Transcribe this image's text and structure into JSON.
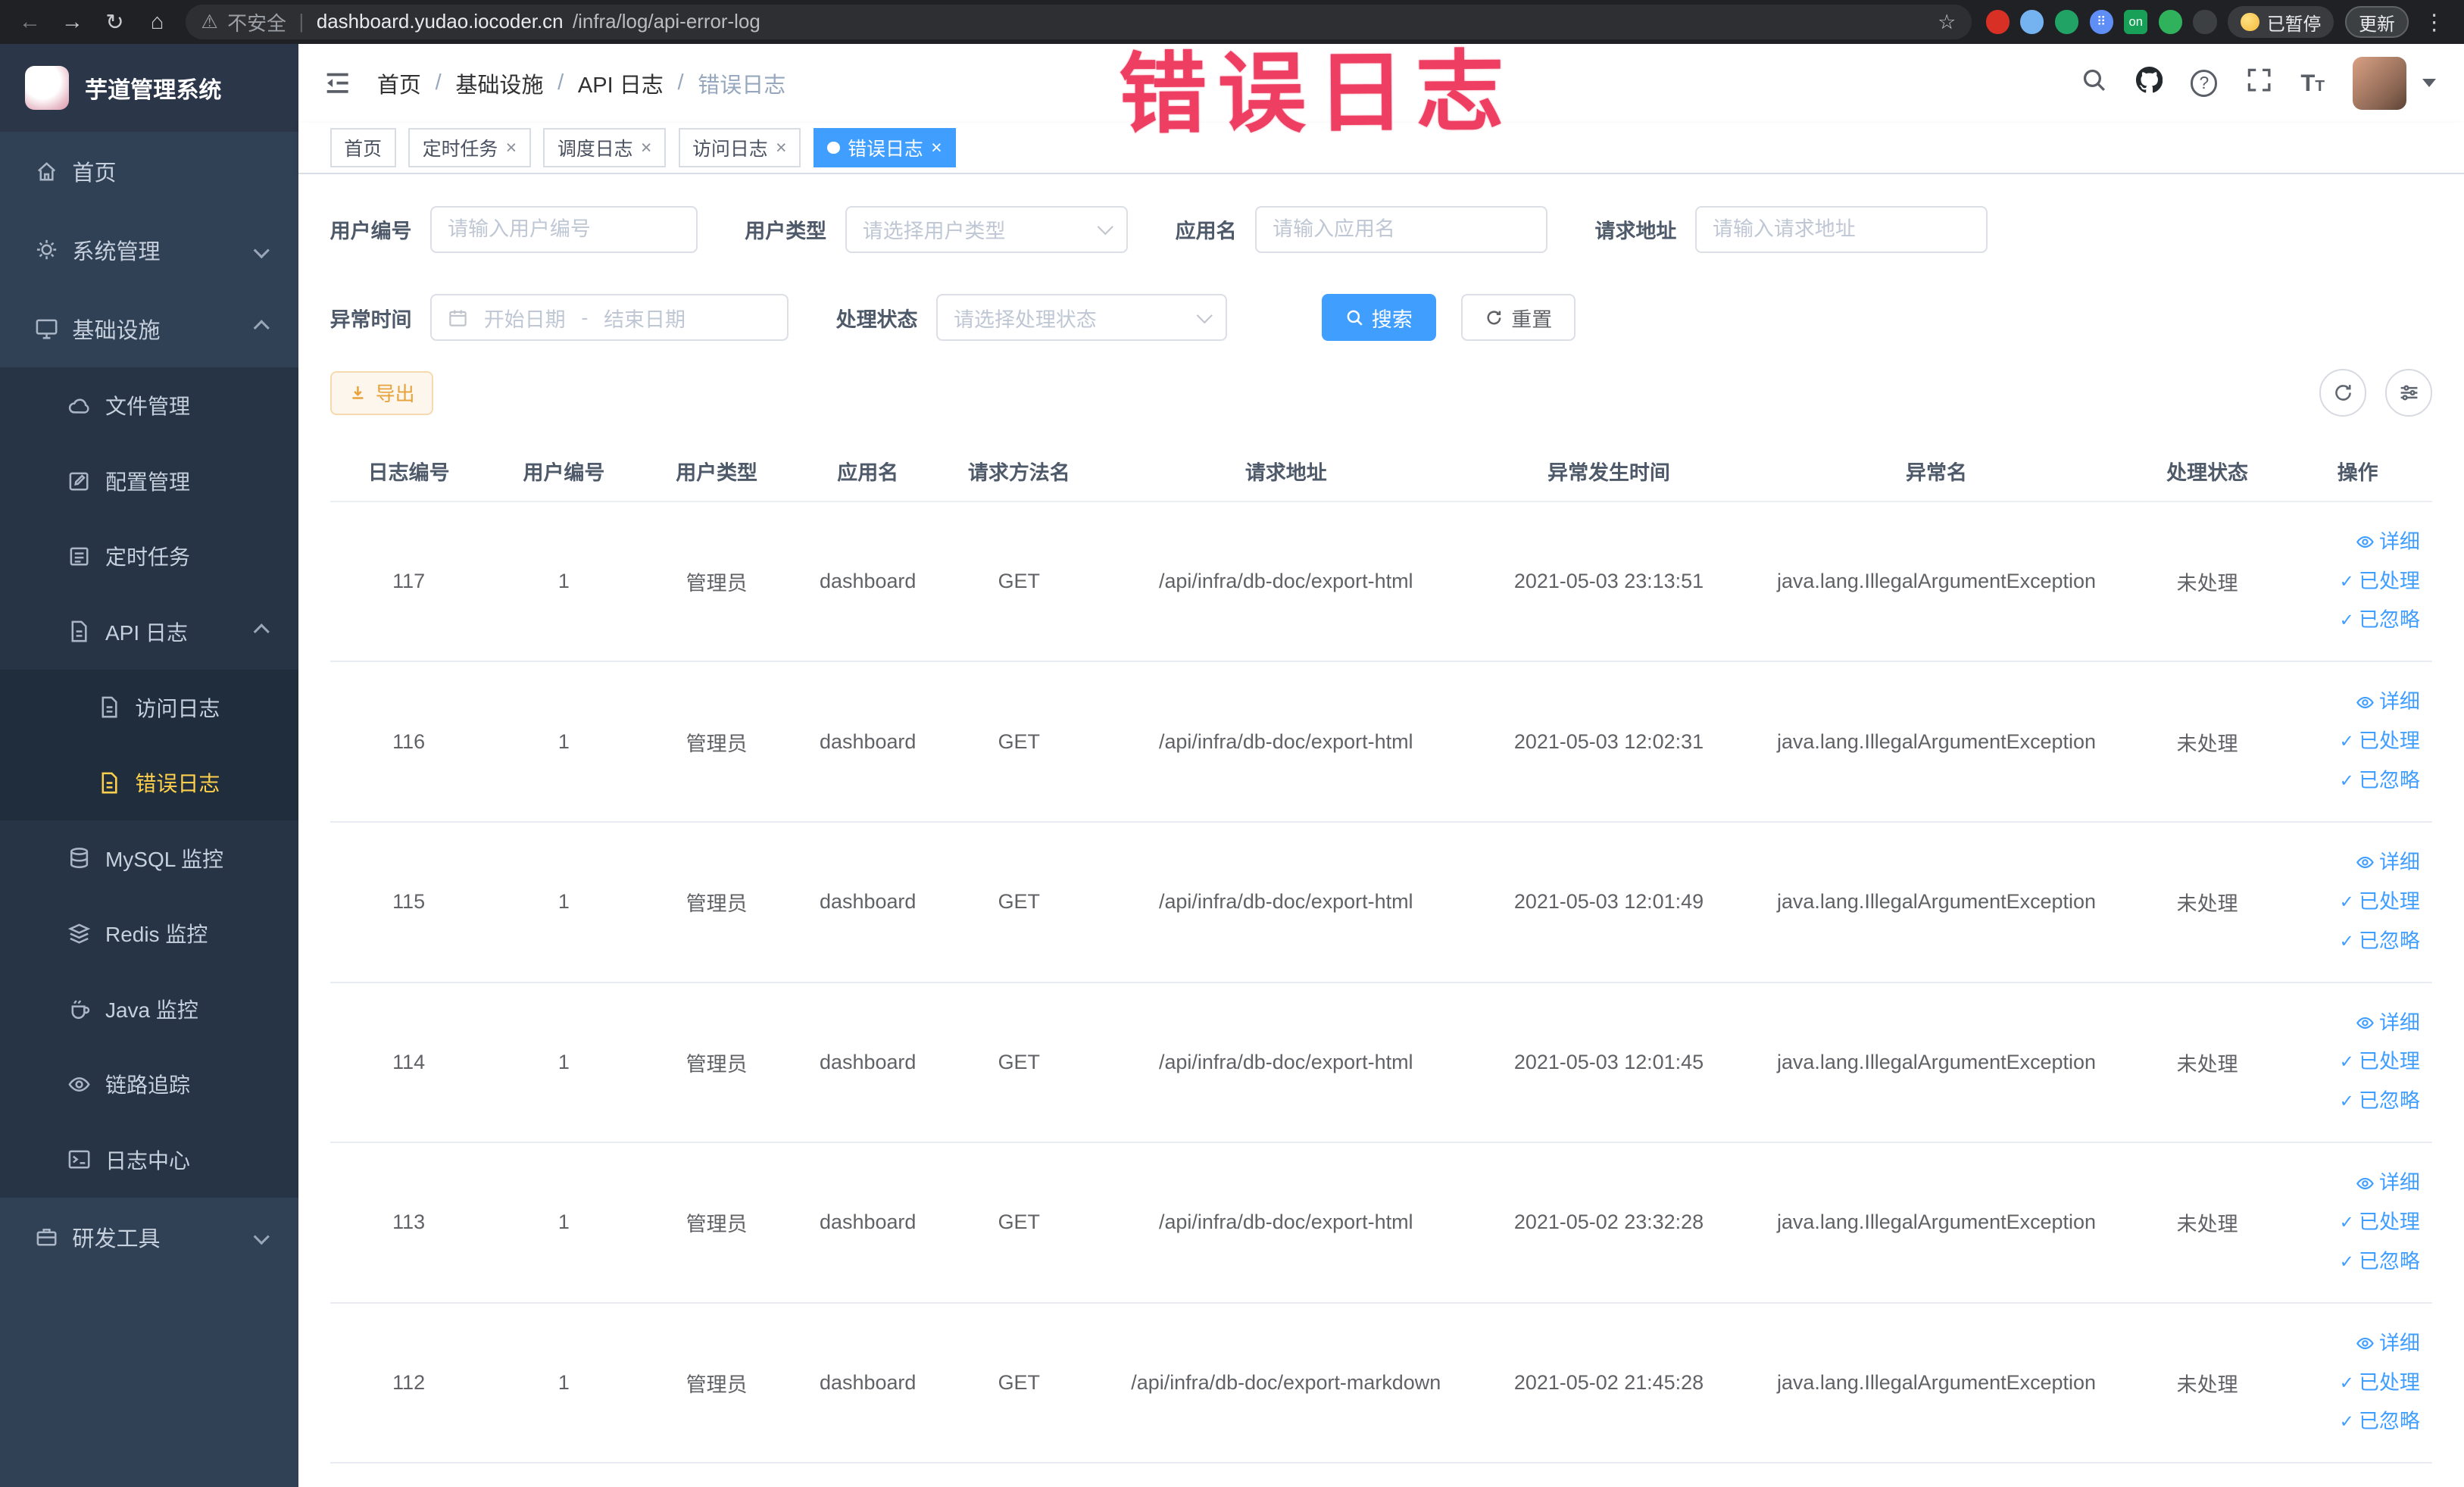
{
  "annotation": {
    "text": "错误日志",
    "color": "#ee3f63"
  },
  "browser": {
    "security_label": "不安全",
    "url_domain": "dashboard.yudao.iocoder.cn",
    "url_path": "/infra/log/api-error-log",
    "ext_on_label": "on",
    "paused_label": "已暂停",
    "update_label": "更新"
  },
  "sidebar": {
    "logo_title": "芋道管理系统",
    "items": [
      {
        "label": "首页",
        "icon": "home-icon",
        "level": 1
      },
      {
        "label": "系统管理",
        "icon": "gear-icon",
        "level": 1,
        "arrow": "down"
      },
      {
        "label": "基础设施",
        "icon": "monitor-icon",
        "level": 1,
        "arrow": "up"
      },
      {
        "label": "文件管理",
        "icon": "cloud-icon",
        "level": 2
      },
      {
        "label": "配置管理",
        "icon": "edit-icon",
        "level": 2
      },
      {
        "label": "定时任务",
        "icon": "list-icon",
        "level": 2
      },
      {
        "label": "API 日志",
        "icon": "doc-icon",
        "level": 2,
        "arrow": "up"
      },
      {
        "label": "访问日志",
        "icon": "doc-lines-icon",
        "level": 3
      },
      {
        "label": "错误日志",
        "icon": "doc-lines-icon",
        "level": 3,
        "active": true
      },
      {
        "label": "MySQL 监控",
        "icon": "database-icon",
        "level": 2
      },
      {
        "label": "Redis 监控",
        "icon": "layers-icon",
        "level": 2
      },
      {
        "label": "Java 监控",
        "icon": "coffee-icon",
        "level": 2
      },
      {
        "label": "链路追踪",
        "icon": "eye-icon",
        "level": 2
      },
      {
        "label": "日志中心",
        "icon": "terminal-icon",
        "level": 2
      },
      {
        "label": "研发工具",
        "icon": "briefcase-icon",
        "level": 1,
        "arrow": "down"
      }
    ]
  },
  "header": {
    "breadcrumb": [
      "首页",
      "基础设施",
      "API 日志",
      "错误日志"
    ]
  },
  "tabs": [
    {
      "label": "首页",
      "closable": false,
      "active": false
    },
    {
      "label": "定时任务",
      "closable": true,
      "active": false
    },
    {
      "label": "调度日志",
      "closable": true,
      "active": false
    },
    {
      "label": "访问日志",
      "closable": true,
      "active": false
    },
    {
      "label": "错误日志",
      "closable": true,
      "active": true
    }
  ],
  "filters": {
    "user_id": {
      "label": "用户编号",
      "placeholder": "请输入用户编号"
    },
    "user_type": {
      "label": "用户类型",
      "placeholder": "请选择用户类型"
    },
    "app_name": {
      "label": "应用名",
      "placeholder": "请输入应用名"
    },
    "request_url": {
      "label": "请求地址",
      "placeholder": "请输入请求地址"
    },
    "exception_time": {
      "label": "异常时间",
      "start_placeholder": "开始日期",
      "separator": "-",
      "end_placeholder": "结束日期"
    },
    "process_status": {
      "label": "处理状态",
      "placeholder": "请选择处理状态"
    },
    "search_label": "搜索",
    "reset_label": "重置"
  },
  "toolbar": {
    "export_label": "导出"
  },
  "table": {
    "columns": [
      "日志编号",
      "用户编号",
      "用户类型",
      "应用名",
      "请求方法名",
      "请求地址",
      "异常发生时间",
      "异常名",
      "处理状态",
      "操作"
    ],
    "actions": [
      "详细",
      "已处理",
      "已忽略"
    ],
    "rows": [
      {
        "id": "117",
        "user_id": "1",
        "user_type": "管理员",
        "app": "dashboard",
        "method": "GET",
        "url": "/api/infra/db-doc/export-html",
        "time": "2021-05-03 23:13:51",
        "exception": "java.lang.IllegalArgumentException",
        "status": "未处理"
      },
      {
        "id": "116",
        "user_id": "1",
        "user_type": "管理员",
        "app": "dashboard",
        "method": "GET",
        "url": "/api/infra/db-doc/export-html",
        "time": "2021-05-03 12:02:31",
        "exception": "java.lang.IllegalArgumentException",
        "status": "未处理"
      },
      {
        "id": "115",
        "user_id": "1",
        "user_type": "管理员",
        "app": "dashboard",
        "method": "GET",
        "url": "/api/infra/db-doc/export-html",
        "time": "2021-05-03 12:01:49",
        "exception": "java.lang.IllegalArgumentException",
        "status": "未处理"
      },
      {
        "id": "114",
        "user_id": "1",
        "user_type": "管理员",
        "app": "dashboard",
        "method": "GET",
        "url": "/api/infra/db-doc/export-html",
        "time": "2021-05-03 12:01:45",
        "exception": "java.lang.IllegalArgumentException",
        "status": "未处理"
      },
      {
        "id": "113",
        "user_id": "1",
        "user_type": "管理员",
        "app": "dashboard",
        "method": "GET",
        "url": "/api/infra/db-doc/export-html",
        "time": "2021-05-02 23:32:28",
        "exception": "java.lang.IllegalArgumentException",
        "status": "未处理"
      },
      {
        "id": "112",
        "user_id": "1",
        "user_type": "管理员",
        "app": "dashboard",
        "method": "GET",
        "url": "/api/infra/db-doc/export-markdown",
        "time": "2021-05-02 21:45:28",
        "exception": "java.lang.IllegalArgumentException",
        "status": "未处理"
      }
    ]
  },
  "colors": {
    "accent": "#409eff",
    "sidebar_bg": "#304156",
    "active_menu": "#ffd04b",
    "warning": "#e6a23c",
    "annotation": "#ee3f63"
  }
}
